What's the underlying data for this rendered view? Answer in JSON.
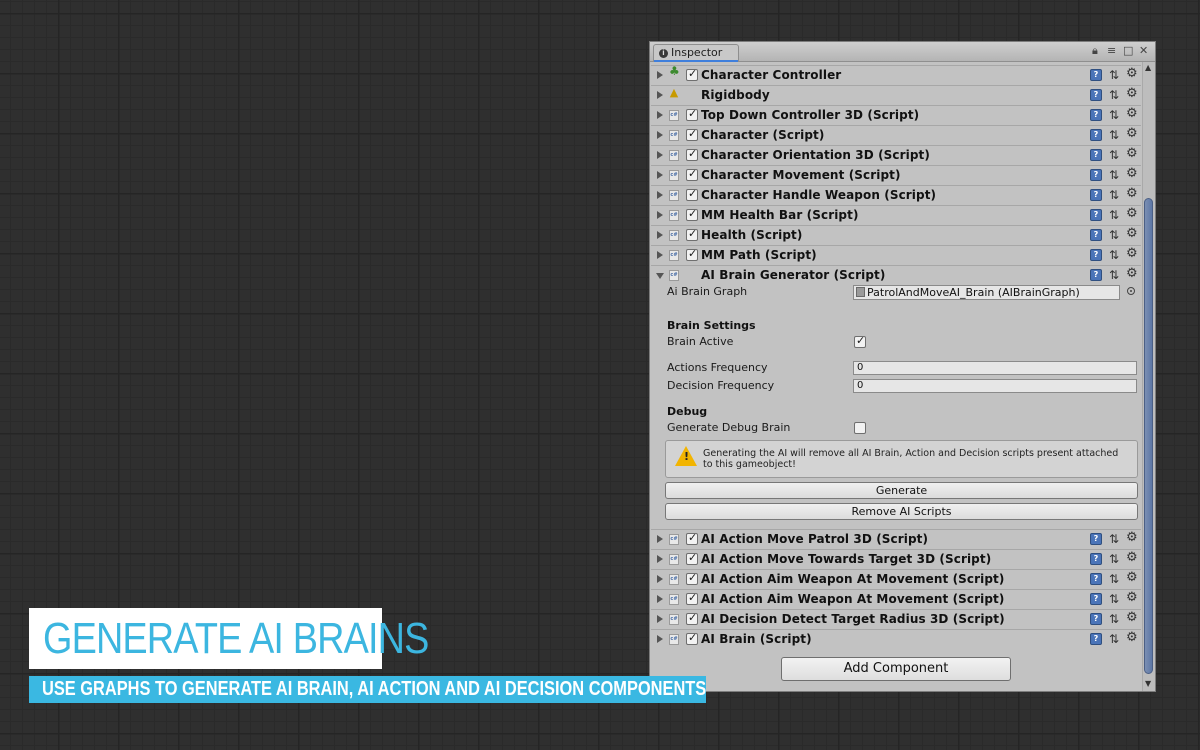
{
  "inspector": {
    "tab_label": "Inspector",
    "components_top": [
      {
        "label": "Character Controller",
        "has_checkbox": true,
        "icon": "character-controller-icon"
      },
      {
        "label": "Rigidbody",
        "has_checkbox": false,
        "icon": "rigidbody-icon"
      },
      {
        "label": "Top Down Controller 3D (Script)",
        "has_checkbox": true,
        "icon": "script-icon"
      },
      {
        "label": "Character (Script)",
        "has_checkbox": true,
        "icon": "script-icon"
      },
      {
        "label": "Character Orientation 3D (Script)",
        "has_checkbox": true,
        "icon": "script-icon"
      },
      {
        "label": "Character Movement (Script)",
        "has_checkbox": true,
        "icon": "script-icon"
      },
      {
        "label": "Character Handle Weapon (Script)",
        "has_checkbox": true,
        "icon": "script-icon"
      },
      {
        "label": "MM Health Bar (Script)",
        "has_checkbox": true,
        "icon": "script-icon"
      },
      {
        "label": "Health (Script)",
        "has_checkbox": true,
        "icon": "script-icon"
      },
      {
        "label": "MM Path (Script)",
        "has_checkbox": true,
        "icon": "script-icon"
      }
    ],
    "generator": {
      "label": "AI Brain Generator (Script)",
      "ai_brain_graph_label": "Ai Brain Graph",
      "ai_brain_graph_value": "PatrolAndMoveAI_Brain (AIBrainGraph)",
      "brain_settings_title": "Brain Settings",
      "brain_active_label": "Brain Active",
      "brain_active": true,
      "actions_frequency_label": "Actions Frequency",
      "actions_frequency": "0",
      "decision_frequency_label": "Decision Frequency",
      "decision_frequency": "0",
      "debug_title": "Debug",
      "generate_debug_brain_label": "Generate Debug Brain",
      "generate_debug_brain": false,
      "warning_text": "Generating the AI will remove all AI Brain, Action and Decision scripts present attached to this gameobject!",
      "generate_button": "Generate",
      "remove_button": "Remove AI Scripts"
    },
    "components_bottom": [
      {
        "label": "AI Action Move Patrol 3D (Script)",
        "has_checkbox": true,
        "icon": "script-icon"
      },
      {
        "label": "AI Action Move Towards Target 3D (Script)",
        "has_checkbox": true,
        "icon": "script-icon"
      },
      {
        "label": "AI Action Aim Weapon At Movement (Script)",
        "has_checkbox": true,
        "icon": "script-icon"
      },
      {
        "label": "AI Action Aim Weapon At Movement (Script)",
        "has_checkbox": true,
        "icon": "script-icon"
      },
      {
        "label": "AI Decision Detect Target Radius 3D (Script)",
        "has_checkbox": true,
        "icon": "script-icon"
      },
      {
        "label": "AI Brain (Script)",
        "has_checkbox": true,
        "icon": "script-icon"
      }
    ],
    "add_component": "Add Component"
  },
  "caption": {
    "title": "GENERATE AI BRAINS",
    "subtitle": "USE GRAPHS TO GENERATE AI BRAIN, AI ACTION AND AI DECISION COMPONENTS"
  },
  "colors": {
    "caption_accent": "#3ab8e2",
    "panel_bg": "#c2c2c2",
    "grid_bg": "#2f2f2f"
  }
}
